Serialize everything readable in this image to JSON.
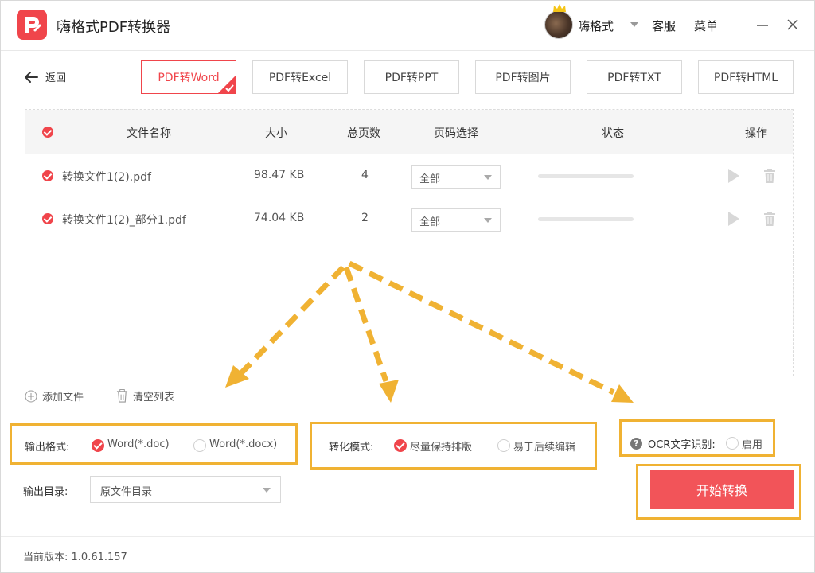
{
  "app": {
    "title": "嗨格式PDF转换器",
    "user_name": "嗨格式",
    "service_label": "客服",
    "menu_label": "菜单"
  },
  "nav": {
    "back_label": "返回",
    "tabs": [
      {
        "label": "PDF转Word",
        "active": true
      },
      {
        "label": "PDF转Excel",
        "active": false
      },
      {
        "label": "PDF转PPT",
        "active": false
      },
      {
        "label": "PDF转图片",
        "active": false
      },
      {
        "label": "PDF转TXT",
        "active": false
      },
      {
        "label": "PDF转HTML",
        "active": false
      }
    ]
  },
  "table": {
    "headers": {
      "name": "文件名称",
      "size": "大小",
      "pages": "总页数",
      "page_select": "页码选择",
      "status": "状态",
      "actions": "操作"
    },
    "rows": [
      {
        "name": "转换文件1(2).pdf",
        "size": "98.47 KB",
        "pages": "4",
        "page_select": "全部",
        "progress": 0
      },
      {
        "name": "转换文件1(2)_部分1.pdf",
        "size": "74.04 KB",
        "pages": "2",
        "page_select": "全部",
        "progress": 0
      }
    ]
  },
  "list_actions": {
    "add_file": "添加文件",
    "clear_list": "清空列表"
  },
  "output_format": {
    "label": "输出格式:",
    "options": [
      {
        "label": "Word(*.doc)",
        "selected": true
      },
      {
        "label": "Word(*.docx)",
        "selected": false
      }
    ]
  },
  "convert_mode": {
    "label": "转化模式:",
    "options": [
      {
        "label": "尽量保持排版",
        "selected": true
      },
      {
        "label": "易于后续编辑",
        "selected": false
      }
    ]
  },
  "ocr": {
    "label": "OCR文字识别:",
    "option_label": "启用",
    "enabled": false
  },
  "output_dir": {
    "label": "输出目录:",
    "value": "原文件目录"
  },
  "start_button": "开始转换",
  "footer": {
    "version_label": "当前版本:",
    "version": "1.0.61.157"
  },
  "colors": {
    "accent": "#f0454b",
    "highlight": "#f0b233",
    "arrow": "#f0b233"
  }
}
